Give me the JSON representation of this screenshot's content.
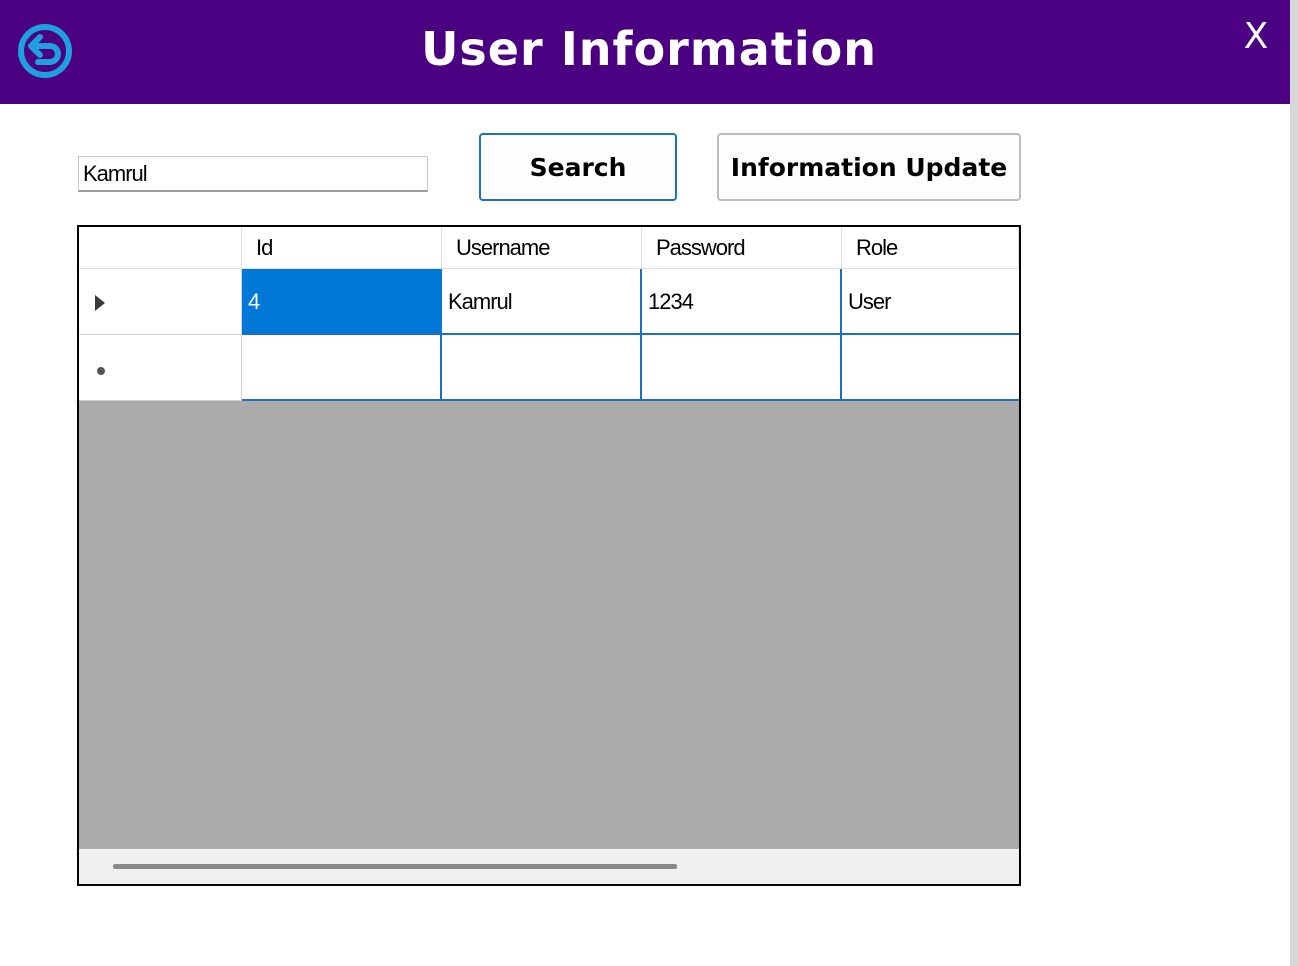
{
  "window": {
    "title": "User Information",
    "close_label": "X",
    "back_icon": "back-arrow-circle-icon"
  },
  "colors": {
    "titlebar": "#4b0082",
    "accent": "#1f6fbf",
    "selection": "#0078d7",
    "grid_background": "#ababab"
  },
  "search": {
    "value": "Kamrul",
    "button_label": "Search"
  },
  "update_button_label": "Information Update",
  "table": {
    "columns": [
      "Id",
      "Username",
      "Password",
      "Role"
    ],
    "rows": [
      {
        "indicator": "current-row-arrow",
        "cells": [
          "4",
          "Kamrul",
          "1234",
          "User"
        ]
      },
      {
        "indicator": "new-row-asterisk",
        "cells": [
          "",
          "",
          "",
          ""
        ]
      }
    ],
    "selected_cell": {
      "row": 0,
      "column": "Id"
    }
  }
}
